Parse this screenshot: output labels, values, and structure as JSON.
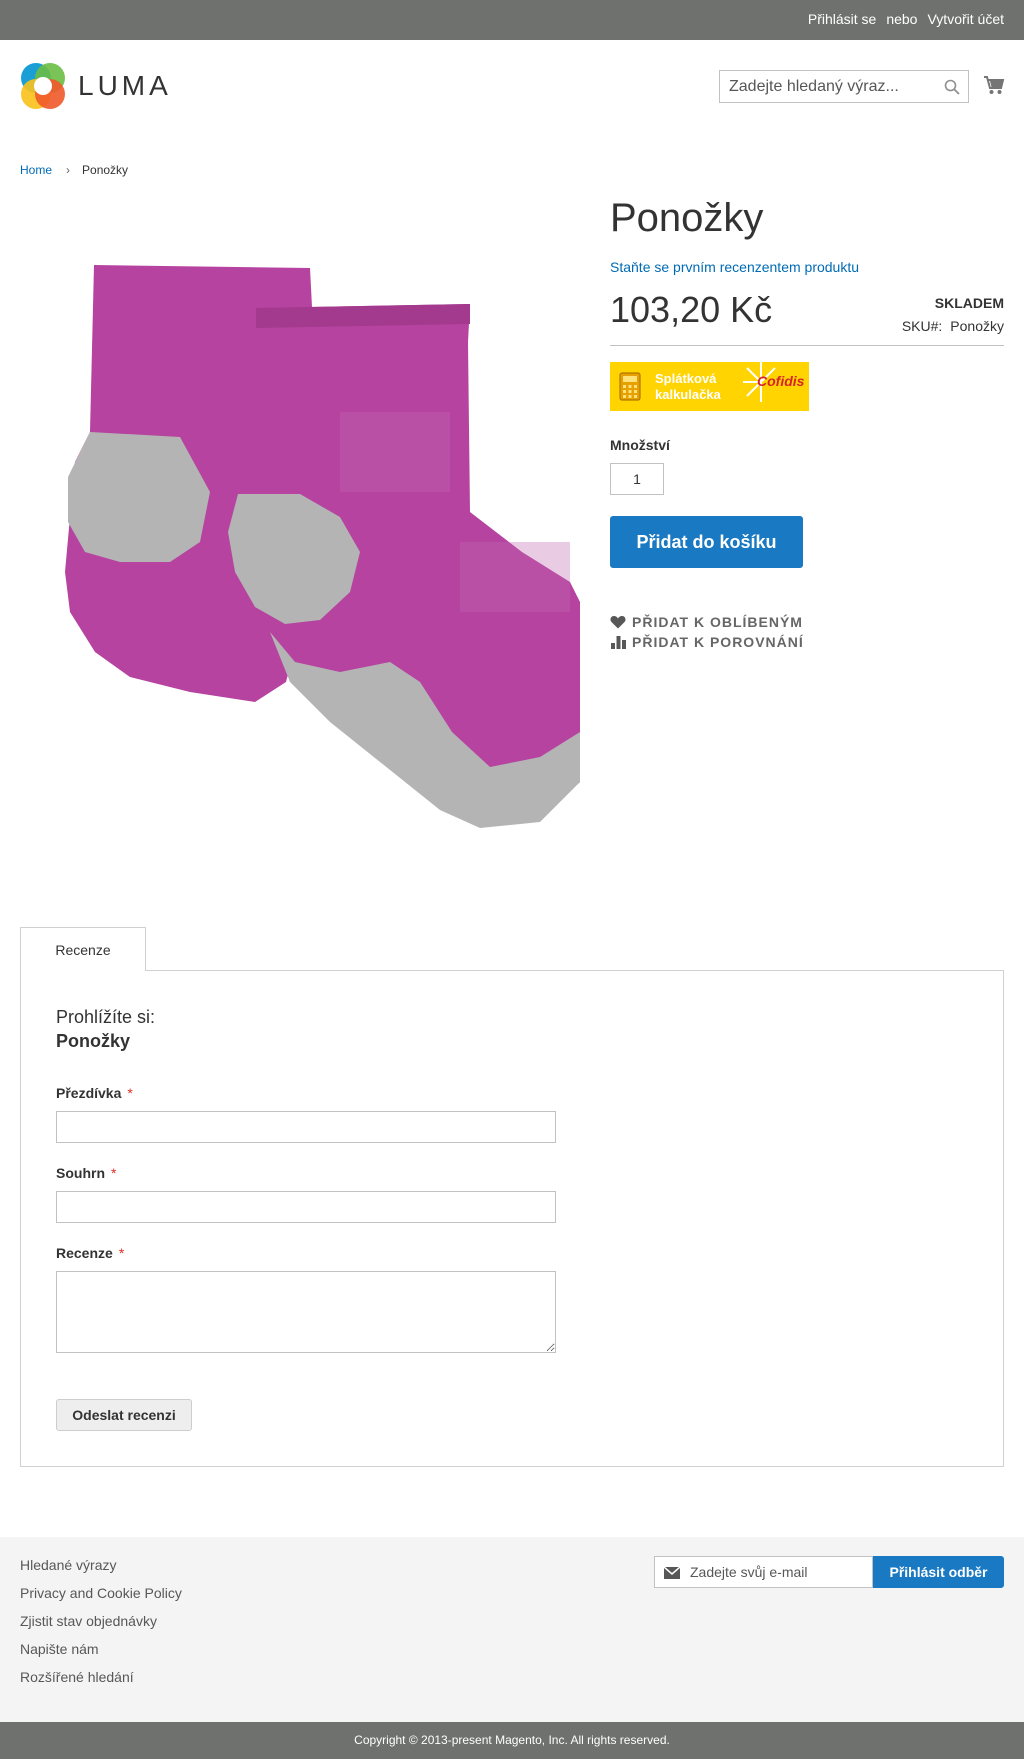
{
  "header": {
    "sign_in": "Přihlásit se",
    "or": "nebo",
    "create_account": "Vytvořit účet"
  },
  "logo": {
    "wordmark": "LUMA"
  },
  "search": {
    "placeholder": "Zadejte hledaný výraz..."
  },
  "breadcrumb": {
    "home": "Home",
    "current": "Ponožky"
  },
  "product": {
    "title": "Ponožky",
    "review_link": "Staňte se prvním recenzentem produktu",
    "price": "103,20 Kč",
    "stock": "Skladem",
    "sku_label": "SKU#:",
    "sku": "Ponožky",
    "banner_line1": "Splátková",
    "banner_line2": "kalkulačka",
    "banner_brand": "Cofidis",
    "qty_label": "Množství",
    "qty": "1",
    "add_to_cart": "Přidat do košíku",
    "wishlist": "Přidat k oblíbeným",
    "compare": "Přidat k porovnání"
  },
  "tabs": {
    "reviews": "Recenze"
  },
  "review_form": {
    "legend": "Prohlížíte si:",
    "product_name": "Ponožky",
    "nickname_label": "Přezdívka",
    "summary_label": "Souhrn",
    "review_label": "Recenze",
    "required": "*",
    "submit": "Odeslat recenzi"
  },
  "footer": {
    "links": [
      "Hledané výrazy",
      "Privacy and Cookie Policy",
      "Zjistit stav objednávky",
      "Napište nám",
      "Rozšířené hledání"
    ],
    "newsletter_placeholder": "Zadejte svůj e-mail",
    "newsletter_button": "Přihlásit odběr",
    "copyright": "Copyright © 2013-present Magento, Inc. All rights reserved."
  },
  "colors": {
    "accent": "#1979c3",
    "link": "#006bb4",
    "bar": "#6e716e",
    "banner": "#ffd400",
    "sock_pink": "#b5439f",
    "sock_grey": "#b4b4b4"
  },
  "icons": [
    "search-icon",
    "cart-icon",
    "heart-icon",
    "compare-icon",
    "mail-icon",
    "calculator-icon"
  ]
}
